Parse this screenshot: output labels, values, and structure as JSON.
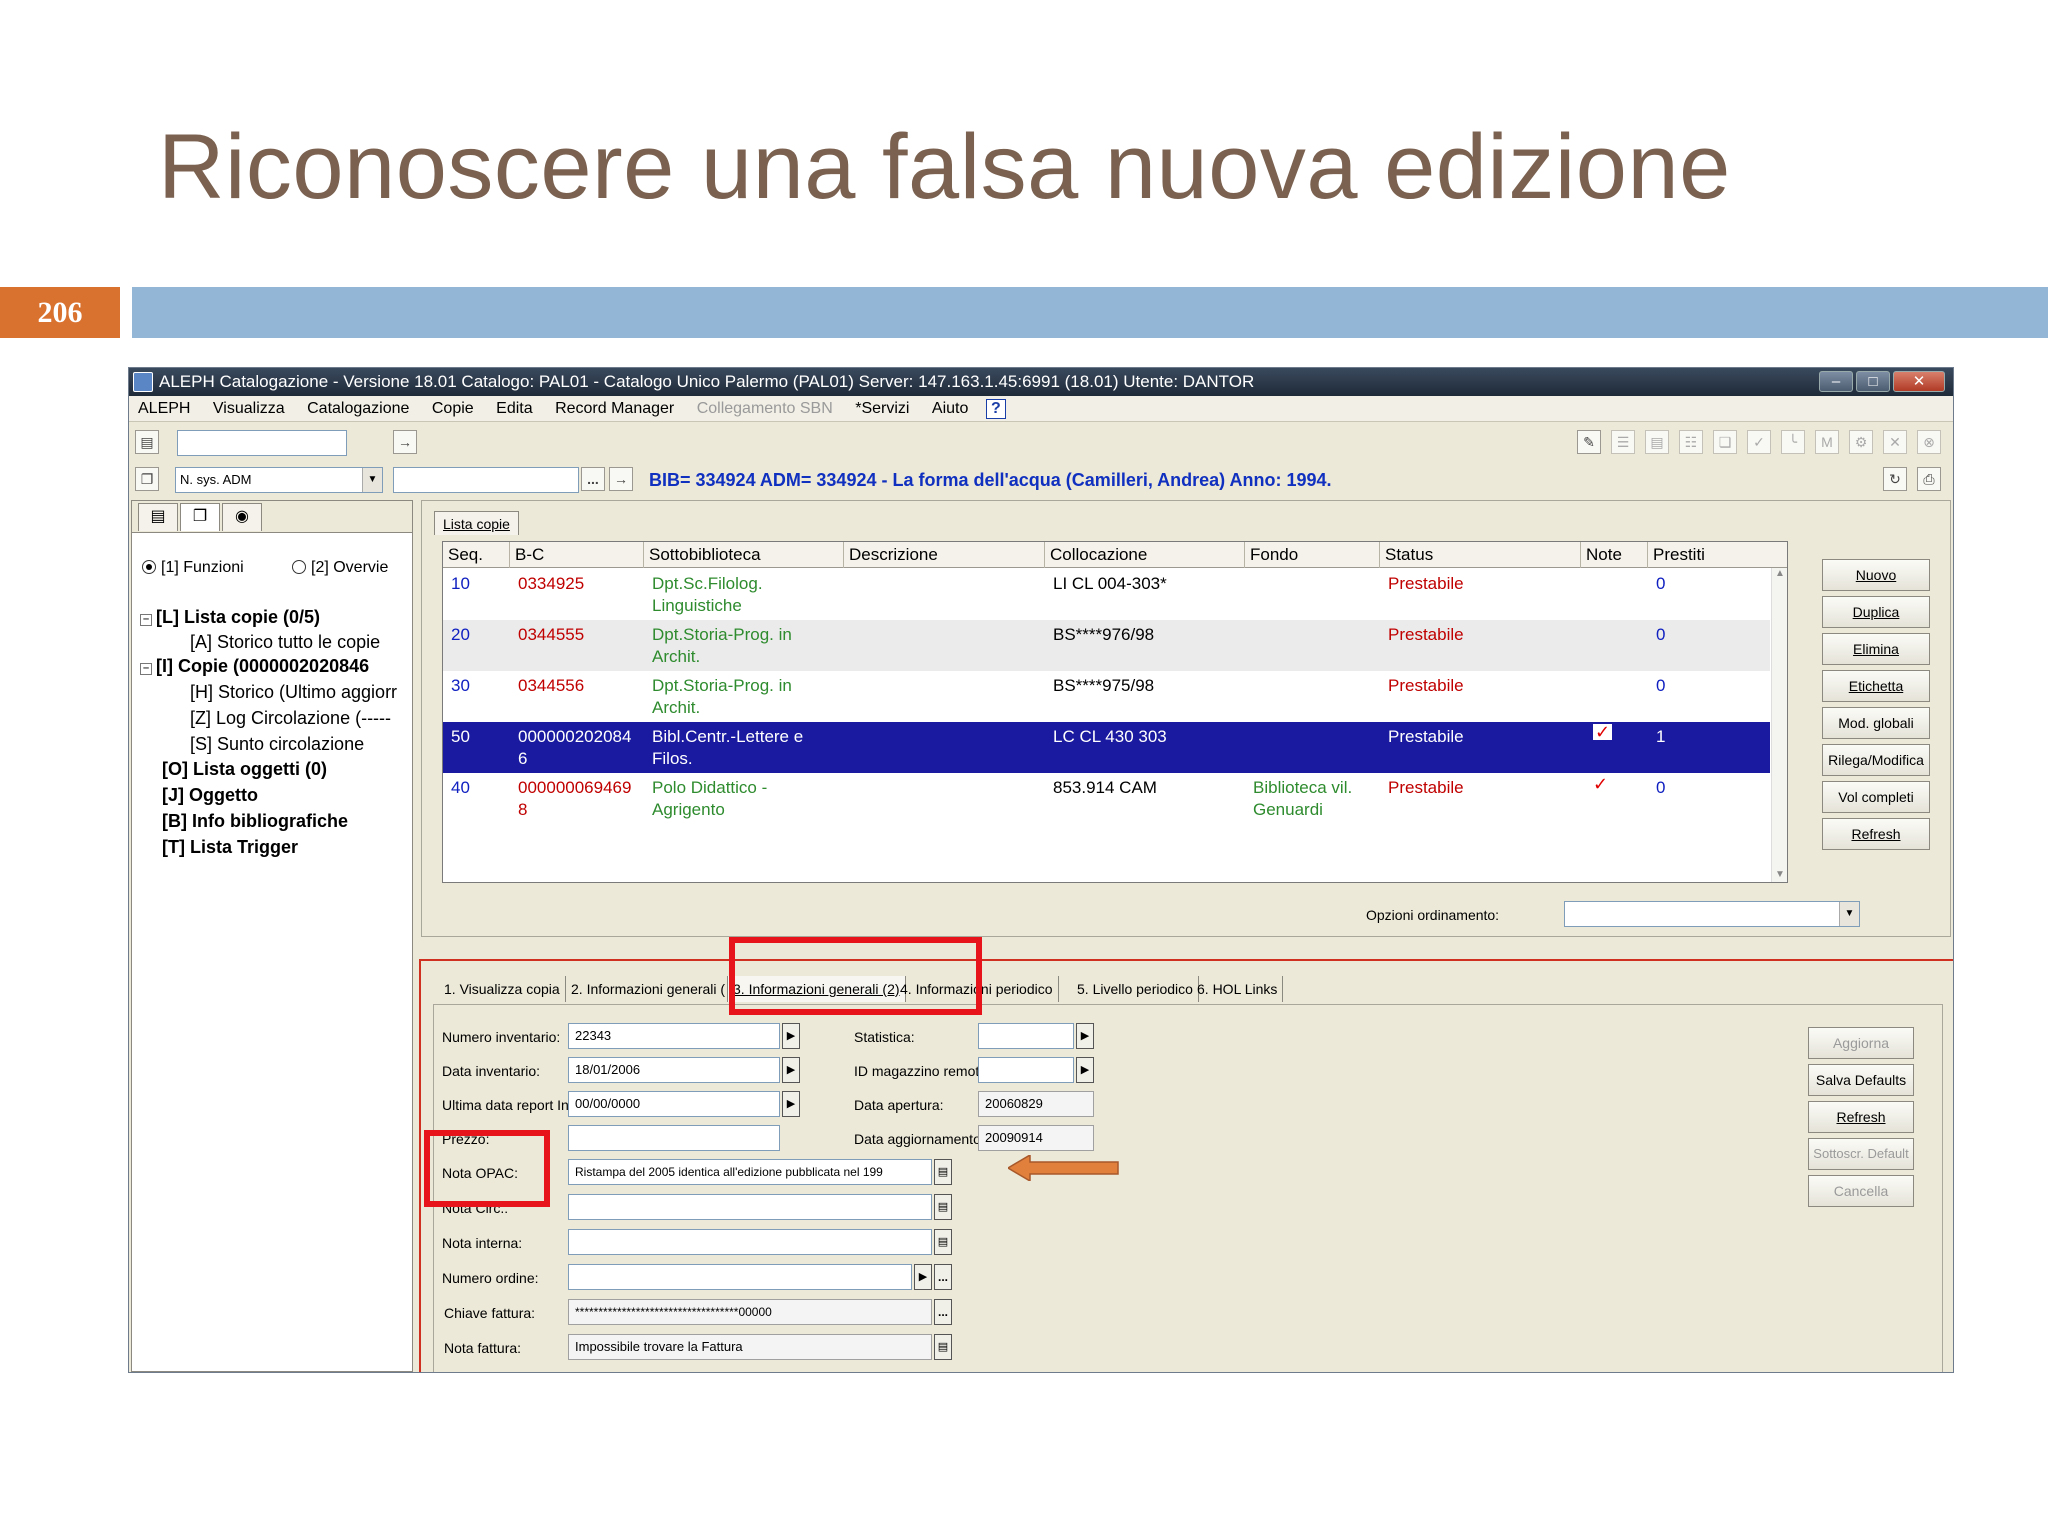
{
  "slide": {
    "title": "Riconoscere una falsa nuova edizione",
    "number": "206"
  },
  "colors": {
    "title": "#7a6150",
    "number_box": "#d9712f",
    "band": "#93b5d6",
    "highlight": "#e8141c",
    "arrow": "#e0803c",
    "selected_row": "#1a1aa0"
  },
  "app": {
    "title": "ALEPH Catalogazione - Versione 18.01  Catalogo:  PAL01 - Catalogo Unico Palermo (PAL01)  Server:  147.163.1.45:6991 (18.01)  Utente:  DANTOR",
    "menu": [
      "ALEPH",
      "Visualizza",
      "Catalogazione",
      "Copie",
      "Edita",
      "Record Manager",
      "Collegamento SBN",
      "*Servizi",
      "Aiuto"
    ],
    "menu_disabled": "Collegamento SBN",
    "help_icon": "?",
    "search_select": "N. sys. ADM",
    "dots_label": "...",
    "bib_line": "BIB= 334924 ADM= 334924 - La forma dell'acqua (Camilleri, Andrea) Anno: 1994.",
    "left": {
      "radio_funzioni": "[1] Funzioni",
      "radio_overview": "[2] Overvie",
      "tree": [
        {
          "label": "[L] Lista copie (0/5)",
          "bold": true,
          "expander": "-"
        },
        {
          "label": "[A] Storico tutto le copie",
          "bold": false
        },
        {
          "label": "[I] Copie (0000002020846",
          "bold": true,
          "expander": "-"
        },
        {
          "label": "[H] Storico (Ultimo aggiorr",
          "bold": false
        },
        {
          "label": "[Z] Log Circolazione (-----",
          "bold": false
        },
        {
          "label": "[S] Sunto circolazione",
          "bold": false
        },
        {
          "label": "[O] Lista oggetti (0)",
          "bold": true
        },
        {
          "label": "[J] Oggetto",
          "bold": true
        },
        {
          "label": "[B] Info bibliografiche",
          "bold": true
        },
        {
          "label": "[T] Lista Trigger",
          "bold": true
        }
      ]
    },
    "copies": {
      "tab": "Lista copie",
      "columns": [
        "Seq.",
        "B-C",
        "Sottobiblioteca",
        "Descrizione",
        "Collocazione",
        "Fondo",
        "Status",
        "Note",
        "Prestiti"
      ],
      "rows": [
        {
          "seq": "10",
          "bc": "0334925",
          "sotto": "Dpt.Sc.Filolog.\nLinguistiche",
          "desc": "",
          "coll": "LI CL 004-303*",
          "fondo": "",
          "status": "Prestabile",
          "note": "",
          "prestiti": "0"
        },
        {
          "seq": "20",
          "bc": "0344555",
          "sotto": "Dpt.Storia-Prog. in\nArchit.",
          "desc": "",
          "coll": "BS****976/98",
          "fondo": "",
          "status": "Prestabile",
          "note": "",
          "prestiti": "0"
        },
        {
          "seq": "30",
          "bc": "0344556",
          "sotto": "Dpt.Storia-Prog. in\nArchit.",
          "desc": "",
          "coll": "BS****975/98",
          "fondo": "",
          "status": "Prestabile",
          "note": "",
          "prestiti": "0"
        },
        {
          "seq": "50",
          "bc": "000000202084\n6",
          "sotto": "Bibl.Centr.-Lettere e\nFilos.",
          "desc": "",
          "coll": "LC CL 430 303",
          "fondo": "",
          "status": "Prestabile",
          "note": "✓",
          "prestiti": "1"
        },
        {
          "seq": "40",
          "bc": "000000069469\n8",
          "sotto": "Polo Didattico -\nAgrigento",
          "desc": "",
          "coll": "853.914 CAM",
          "fondo": "Biblioteca vil.\nGenuardi",
          "status": "Prestabile",
          "note": "✓",
          "prestiti": "0"
        }
      ],
      "buttons": [
        "Nuovo",
        "Duplica",
        "Elimina",
        "Etichetta",
        "Mod. globali",
        "Rilega/Modifica",
        "Vol completi",
        "Refresh"
      ],
      "sort_label": "Opzioni ordinamento:"
    },
    "form": {
      "tabs": [
        "1. Visualizza copia",
        "2. Informazioni generali (",
        "3. Informazioni generali (2)",
        "4. Informazioni periodico",
        "5. Livello periodico",
        "6. HOL Links"
      ],
      "active_tab": "3. Informazioni generali (2)",
      "fields_left": [
        {
          "label": "Numero inventario:",
          "value": "22343"
        },
        {
          "label": "Data inventario:",
          "value": "18/01/2006"
        },
        {
          "label": "Ultima data report Inve",
          "value": "00/00/0000"
        },
        {
          "label": "Prezzo:",
          "value": ""
        },
        {
          "label": "Nota OPAC:",
          "value": "Ristampa del 2005 identica all'edizione pubblicata nel 199"
        },
        {
          "label": "Nota Circ.:",
          "value": ""
        },
        {
          "label": "Nota interna:",
          "value": ""
        },
        {
          "label": "Numero ordine:",
          "value": ""
        },
        {
          "label": "Chiave fattura:",
          "value": "***********************************00000"
        },
        {
          "label": "Nota fattura:",
          "value": "Impossibile trovare la Fattura"
        }
      ],
      "fields_right": [
        {
          "label": "Statistica:",
          "value": ""
        },
        {
          "label": "ID magazzino remoto:",
          "value": ""
        },
        {
          "label": "Data apertura:",
          "value": "20060829"
        },
        {
          "label": "Data aggiornamento:",
          "value": "20090914"
        }
      ],
      "buttons": [
        {
          "label": "Aggiorna",
          "disabled": true
        },
        {
          "label": "Salva Defaults",
          "disabled": false
        },
        {
          "label": "Refresh",
          "disabled": false
        },
        {
          "label": "Sottoscr. Default",
          "disabled": true
        },
        {
          "label": "Cancella",
          "disabled": true
        }
      ]
    }
  }
}
